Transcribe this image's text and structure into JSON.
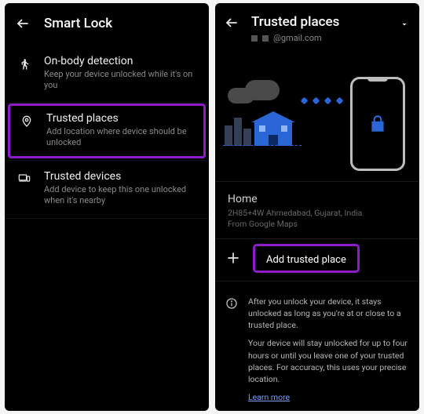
{
  "left": {
    "title": "Smart Lock",
    "options": {
      "onbody": {
        "title": "On-body detection",
        "desc": "Keep your device unlocked while it's on you"
      },
      "trusted_places": {
        "title": "Trusted places",
        "desc": "Add location where device should be unlocked"
      },
      "trusted_devices": {
        "title": "Trusted devices",
        "desc": "Add device to keep this one unlocked when it's nearby"
      }
    }
  },
  "right": {
    "title": "Trusted places",
    "account_suffix": "@gmail.com",
    "home": {
      "title": "Home",
      "address": "2H85+4W Ahmedabad, Gujarat, India",
      "source": "From Google Maps"
    },
    "add_label": "Add trusted place",
    "info": {
      "p1": "After you unlock your device, it stays unlocked as long as you're at or close to a trusted place.",
      "p2": "Your device will stay unlocked for up to four hours or until you leave one of your trusted places. For accuracy, this uses your precise location.",
      "learn": "Learn more"
    }
  }
}
